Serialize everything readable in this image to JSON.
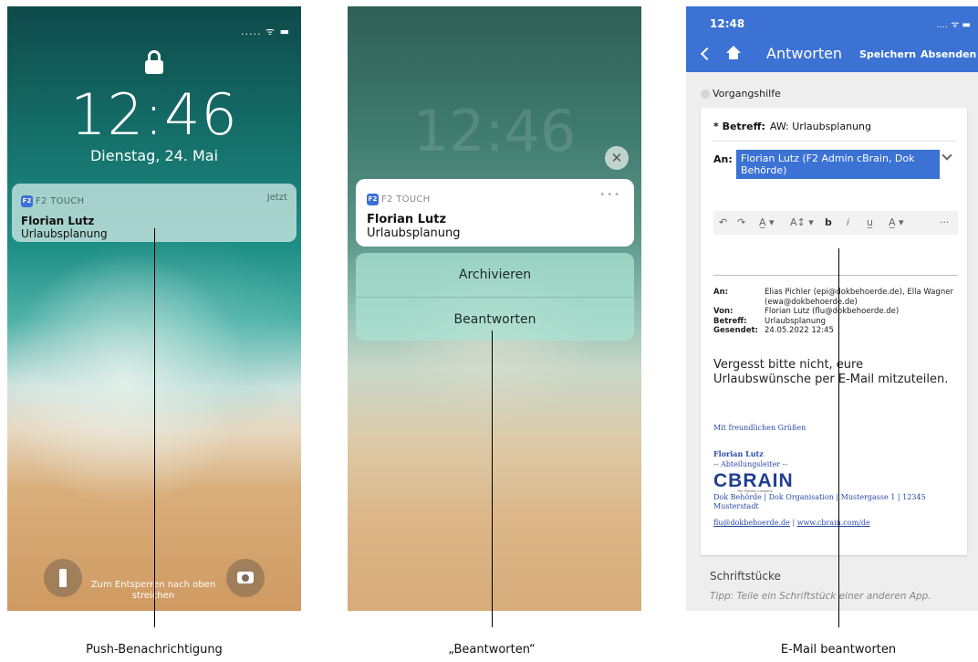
{
  "lock_screen": {
    "status": "..... ᯤ ▬",
    "time": "12:46",
    "date": "Dienstag, 24. Mai",
    "notification": {
      "app_badge": "F2",
      "app_name": "F2 TOUCH",
      "time": "Jetzt",
      "sender": "Florian Lutz",
      "message": "Urlaubsplanung"
    },
    "unlock_hint": "Zum Entsperren nach oben streichen"
  },
  "expanded_notification": {
    "close_glyph": "✕",
    "app_badge": "F2",
    "app_name": "F2 TOUCH",
    "more": "•••",
    "sender": "Florian Lutz",
    "message": "Urlaubsplanung",
    "actions": [
      "Archivieren",
      "Beantworten"
    ]
  },
  "reply_screen": {
    "status_time": "12:48",
    "status_icons": ".... ᯤ ▬",
    "nav": {
      "title": "Antworten",
      "save": "Speichern",
      "send": "Absenden"
    },
    "help_label": "Vorgangshilfe",
    "subject_label": "* Betreff:",
    "subject_value": "AW: Urlaubsplanung",
    "to_label": "An:",
    "to_value": "Florian Lutz (F2 Admin cBrain, Dok Behörde)",
    "toolbar": [
      "↶",
      "↷",
      "A̲ ▾",
      "A↕ ▾",
      "b",
      "𝑖",
      "u̲",
      "A̲ ▾",
      "···"
    ],
    "quote": {
      "to_label": "An:",
      "to_value": "Elias Pichler (epi@dokbehoerde.de), Ella Wagner (ewa@dokbehoerde.de)",
      "from_label": "Von:",
      "from_value": "Florian Lutz (flu@dokbehoerde.de)",
      "subject_label": "Betreff:",
      "subject_value": "Urlaubsplanung",
      "sent_label": "Gesendet:",
      "sent_value": "24.05.2022 12:45"
    },
    "body": "Vergesst bitte nicht, eure Urlaubswünsche per E-Mail mitzuteilen.",
    "signature": {
      "greeting": "Mit freundlichen Grüßen",
      "name": "Florian Lutz",
      "role": "-- Abteilungsleiter --",
      "logo": "CBRAIN",
      "logo_tagline": "The Process Company",
      "address": "Dok Behörde  |  Dok Organisation  |  Mustergasse 1  |  12345 Musterstadt",
      "email": "flu@dokbehoerde.de",
      "separator": "|",
      "website": "www.cbrain.com/de"
    },
    "documents_title": "Schriftstücke",
    "documents_tip": "Tipp: Teile ein Schriftstück einer anderen App."
  },
  "captions": {
    "left": "Push-Benachrichtigung",
    "middle": "„Beantworten“",
    "right": "E-Mail beantworten"
  }
}
